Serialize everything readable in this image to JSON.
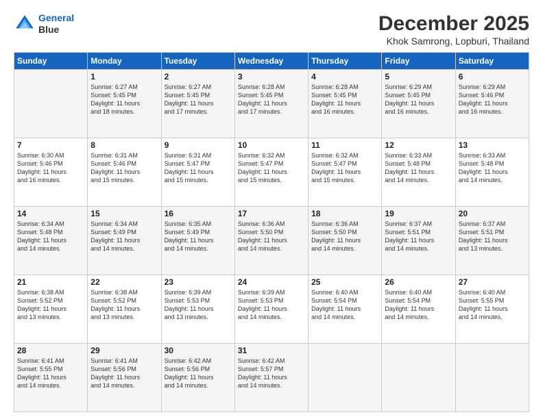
{
  "logo": {
    "line1": "General",
    "line2": "Blue"
  },
  "title": "December 2025",
  "subtitle": "Khok Samrong, Lopburi, Thailand",
  "header_days": [
    "Sunday",
    "Monday",
    "Tuesday",
    "Wednesday",
    "Thursday",
    "Friday",
    "Saturday"
  ],
  "weeks": [
    [
      {
        "day": "",
        "sunrise": "",
        "sunset": "",
        "daylight": ""
      },
      {
        "day": "1",
        "sunrise": "Sunrise: 6:27 AM",
        "sunset": "Sunset: 5:45 PM",
        "daylight": "Daylight: 11 hours and 18 minutes."
      },
      {
        "day": "2",
        "sunrise": "Sunrise: 6:27 AM",
        "sunset": "Sunset: 5:45 PM",
        "daylight": "Daylight: 11 hours and 17 minutes."
      },
      {
        "day": "3",
        "sunrise": "Sunrise: 6:28 AM",
        "sunset": "Sunset: 5:45 PM",
        "daylight": "Daylight: 11 hours and 17 minutes."
      },
      {
        "day": "4",
        "sunrise": "Sunrise: 6:28 AM",
        "sunset": "Sunset: 5:45 PM",
        "daylight": "Daylight: 11 hours and 16 minutes."
      },
      {
        "day": "5",
        "sunrise": "Sunrise: 6:29 AM",
        "sunset": "Sunset: 5:45 PM",
        "daylight": "Daylight: 11 hours and 16 minutes."
      },
      {
        "day": "6",
        "sunrise": "Sunrise: 6:29 AM",
        "sunset": "Sunset: 5:46 PM",
        "daylight": "Daylight: 11 hours and 16 minutes."
      }
    ],
    [
      {
        "day": "7",
        "sunrise": "Sunrise: 6:30 AM",
        "sunset": "Sunset: 5:46 PM",
        "daylight": "Daylight: 11 hours and 16 minutes."
      },
      {
        "day": "8",
        "sunrise": "Sunrise: 6:31 AM",
        "sunset": "Sunset: 5:46 PM",
        "daylight": "Daylight: 11 hours and 15 minutes."
      },
      {
        "day": "9",
        "sunrise": "Sunrise: 6:31 AM",
        "sunset": "Sunset: 5:47 PM",
        "daylight": "Daylight: 11 hours and 15 minutes."
      },
      {
        "day": "10",
        "sunrise": "Sunrise: 6:32 AM",
        "sunset": "Sunset: 5:47 PM",
        "daylight": "Daylight: 11 hours and 15 minutes."
      },
      {
        "day": "11",
        "sunrise": "Sunrise: 6:32 AM",
        "sunset": "Sunset: 5:47 PM",
        "daylight": "Daylight: 11 hours and 15 minutes."
      },
      {
        "day": "12",
        "sunrise": "Sunrise: 6:33 AM",
        "sunset": "Sunset: 5:48 PM",
        "daylight": "Daylight: 11 hours and 14 minutes."
      },
      {
        "day": "13",
        "sunrise": "Sunrise: 6:33 AM",
        "sunset": "Sunset: 5:48 PM",
        "daylight": "Daylight: 11 hours and 14 minutes."
      }
    ],
    [
      {
        "day": "14",
        "sunrise": "Sunrise: 6:34 AM",
        "sunset": "Sunset: 5:48 PM",
        "daylight": "Daylight: 11 hours and 14 minutes."
      },
      {
        "day": "15",
        "sunrise": "Sunrise: 6:34 AM",
        "sunset": "Sunset: 5:49 PM",
        "daylight": "Daylight: 11 hours and 14 minutes."
      },
      {
        "day": "16",
        "sunrise": "Sunrise: 6:35 AM",
        "sunset": "Sunset: 5:49 PM",
        "daylight": "Daylight: 11 hours and 14 minutes."
      },
      {
        "day": "17",
        "sunrise": "Sunrise: 6:36 AM",
        "sunset": "Sunset: 5:50 PM",
        "daylight": "Daylight: 11 hours and 14 minutes."
      },
      {
        "day": "18",
        "sunrise": "Sunrise: 6:36 AM",
        "sunset": "Sunset: 5:50 PM",
        "daylight": "Daylight: 11 hours and 14 minutes."
      },
      {
        "day": "19",
        "sunrise": "Sunrise: 6:37 AM",
        "sunset": "Sunset: 5:51 PM",
        "daylight": "Daylight: 11 hours and 14 minutes."
      },
      {
        "day": "20",
        "sunrise": "Sunrise: 6:37 AM",
        "sunset": "Sunset: 5:51 PM",
        "daylight": "Daylight: 11 hours and 13 minutes."
      }
    ],
    [
      {
        "day": "21",
        "sunrise": "Sunrise: 6:38 AM",
        "sunset": "Sunset: 5:52 PM",
        "daylight": "Daylight: 11 hours and 13 minutes."
      },
      {
        "day": "22",
        "sunrise": "Sunrise: 6:38 AM",
        "sunset": "Sunset: 5:52 PM",
        "daylight": "Daylight: 11 hours and 13 minutes."
      },
      {
        "day": "23",
        "sunrise": "Sunrise: 6:39 AM",
        "sunset": "Sunset: 5:53 PM",
        "daylight": "Daylight: 11 hours and 13 minutes."
      },
      {
        "day": "24",
        "sunrise": "Sunrise: 6:39 AM",
        "sunset": "Sunset: 5:53 PM",
        "daylight": "Daylight: 11 hours and 14 minutes."
      },
      {
        "day": "25",
        "sunrise": "Sunrise: 6:40 AM",
        "sunset": "Sunset: 5:54 PM",
        "daylight": "Daylight: 11 hours and 14 minutes."
      },
      {
        "day": "26",
        "sunrise": "Sunrise: 6:40 AM",
        "sunset": "Sunset: 5:54 PM",
        "daylight": "Daylight: 11 hours and 14 minutes."
      },
      {
        "day": "27",
        "sunrise": "Sunrise: 6:40 AM",
        "sunset": "Sunset: 5:55 PM",
        "daylight": "Daylight: 11 hours and 14 minutes."
      }
    ],
    [
      {
        "day": "28",
        "sunrise": "Sunrise: 6:41 AM",
        "sunset": "Sunset: 5:55 PM",
        "daylight": "Daylight: 11 hours and 14 minutes."
      },
      {
        "day": "29",
        "sunrise": "Sunrise: 6:41 AM",
        "sunset": "Sunset: 5:56 PM",
        "daylight": "Daylight: 11 hours and 14 minutes."
      },
      {
        "day": "30",
        "sunrise": "Sunrise: 6:42 AM",
        "sunset": "Sunset: 5:56 PM",
        "daylight": "Daylight: 11 hours and 14 minutes."
      },
      {
        "day": "31",
        "sunrise": "Sunrise: 6:42 AM",
        "sunset": "Sunset: 5:57 PM",
        "daylight": "Daylight: 11 hours and 14 minutes."
      },
      {
        "day": "",
        "sunrise": "",
        "sunset": "",
        "daylight": ""
      },
      {
        "day": "",
        "sunrise": "",
        "sunset": "",
        "daylight": ""
      },
      {
        "day": "",
        "sunrise": "",
        "sunset": "",
        "daylight": ""
      }
    ]
  ]
}
